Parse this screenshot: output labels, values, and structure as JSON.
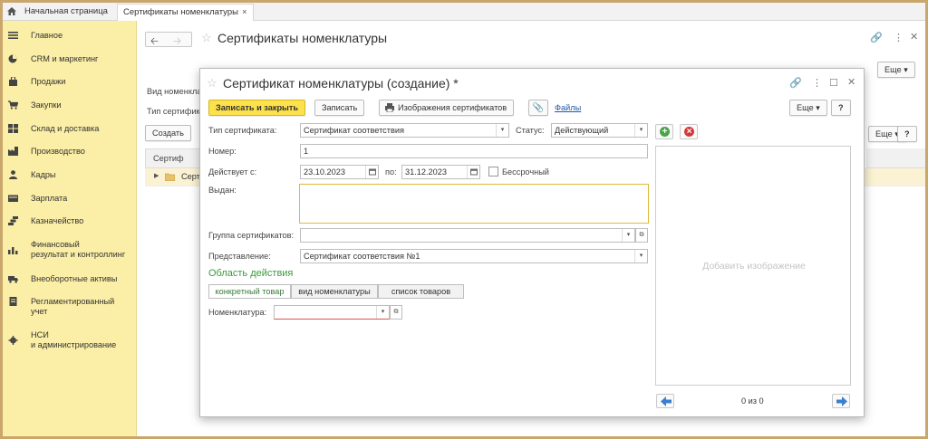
{
  "tabs": {
    "home": "Начальная страница",
    "active": "Сертификаты номенклатуры",
    "close": "×"
  },
  "sidebar": {
    "items": [
      {
        "label": "Главное",
        "icon": "menu-lines-icon"
      },
      {
        "label": "CRM и маркетинг",
        "icon": "pie-chart-icon"
      },
      {
        "label": "Продажи",
        "icon": "shopping-bag-icon"
      },
      {
        "label": "Закупки",
        "icon": "cart-icon"
      },
      {
        "label": "Склад и доставка",
        "icon": "warehouse-icon"
      },
      {
        "label": "Производство",
        "icon": "factory-icon"
      },
      {
        "label": "Кадры",
        "icon": "person-icon"
      },
      {
        "label": "Зарплата",
        "icon": "wallet-icon"
      },
      {
        "label": "Казначейство",
        "icon": "coins-icon"
      },
      {
        "label": "Финансовый\nрезультат и контроллинг",
        "icon": "bar-chart-icon"
      },
      {
        "label": "Внеоборотные активы",
        "icon": "truck-icon"
      },
      {
        "label": "Регламентированный\nучет",
        "icon": "document-icon"
      },
      {
        "label": "НСИ\nи администрирование",
        "icon": "gear-icon"
      }
    ]
  },
  "main": {
    "title": "Сертификаты номенклатуры",
    "more": "Еще",
    "create": "Создать",
    "bg_label1": "Вид номенкла",
    "bg_label2": "Тип сертифика",
    "list_header": "Сертиф",
    "list_row": "Серт",
    "more2": "Еще",
    "help": "?"
  },
  "dialog": {
    "title": "Сертификат номенклатуры (создание) *",
    "btn_save_close": "Записать и закрыть",
    "btn_save": "Записать",
    "btn_images": "Изображения сертификатов",
    "link_files": "Файлы",
    "btn_more": "Еще",
    "btn_help": "?",
    "type_label": "Тип сертификата:",
    "type_value": "Сертификат соответствия",
    "status_label": "Статус:",
    "status_value": "Действующий",
    "number_label": "Номер:",
    "number_value": "1",
    "valid_label": "Действует с:",
    "valid_from": "23.10.2023",
    "to_label": "по:",
    "valid_to": "31.12.2023",
    "perpetual_label": "Бессрочный",
    "issued_label": "Выдан:",
    "group_label": "Группа сертификатов:",
    "repr_label": "Представление:",
    "repr_value": "Сертификат соответствия №1",
    "scope_title": "Область действия",
    "scope_tabs": [
      "конкретный товар",
      "вид номенклатуры",
      "список товаров"
    ],
    "nomenclature_label": "Номенклатура:",
    "add_image_hint": "Добавить изображение",
    "counter": "0 из 0"
  },
  "colors": {
    "primary": "#fce14a",
    "sidebar": "#fbeea6",
    "section": "#3a9a3a",
    "link": "#1f5aa8"
  }
}
